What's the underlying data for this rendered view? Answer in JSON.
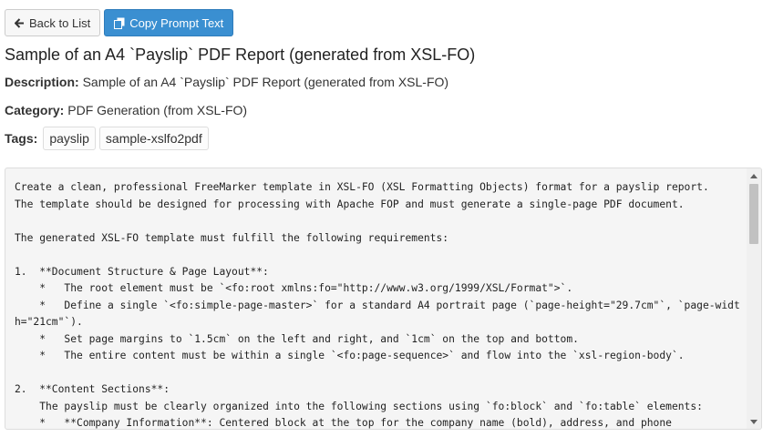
{
  "toolbar": {
    "back_label": "Back to List",
    "copy_label": "Copy Prompt Text"
  },
  "page_title": "Sample of an A4 `Payslip` PDF Report (generated from XSL-FO)",
  "description": {
    "label": "Description:",
    "value": "Sample of an A4 `Payslip` PDF Report (generated from XSL-FO)"
  },
  "category": {
    "label": "Category:",
    "value": "PDF Generation (from XSL-FO)"
  },
  "tags": {
    "label": "Tags:",
    "items": [
      "payslip",
      "sample-xslfo2pdf"
    ]
  },
  "prompt_lines": [
    "Create a clean, professional FreeMarker template in XSL-FO (XSL Formatting Objects) format for a payslip report.",
    "The template should be designed for processing with Apache FOP and must generate a single-page PDF document.",
    "",
    "The generated XSL-FO template must fulfill the following requirements:",
    "",
    "1.  **Document Structure & Page Layout**:",
    "    *   The root element must be `<fo:root xmlns:fo=\"http://www.w3.org/1999/XSL/Format\">`.",
    "    *   Define a single `<fo:simple-page-master>` for a standard A4 portrait page (`page-height=\"29.7cm\"`, `page-width=\"21cm\"`).",
    "    *   Set page margins to `1.5cm` on the left and right, and `1cm` on the top and bottom.",
    "    *   The entire content must be within a single `<fo:page-sequence>` and flow into the `xsl-region-body`.",
    "",
    "2.  **Content Sections**:",
    "    The payslip must be clearly organized into the following sections using `fo:block` and `fo:table` elements:",
    "    *   **Company Information**: Centered block at the top for the company name (bold), address, and phone"
  ]
}
